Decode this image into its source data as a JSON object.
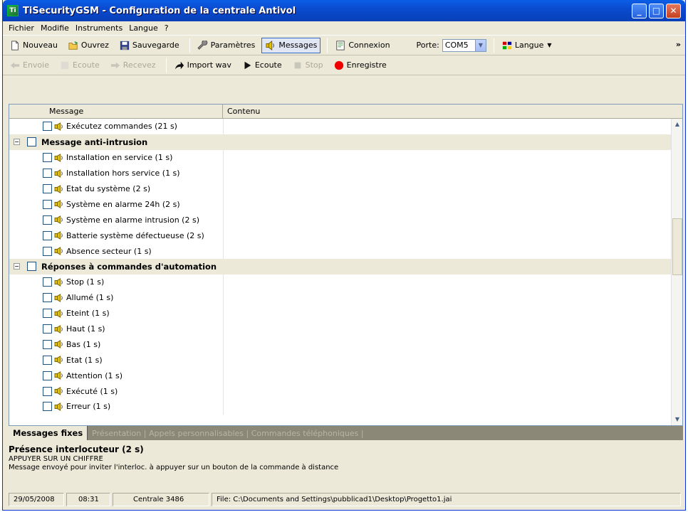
{
  "window": {
    "title": "TiSecurityGSM - Configuration de la centrale Antivol",
    "minimize": "_",
    "maximize": "□",
    "close": "✕"
  },
  "menu": [
    "Fichier",
    "Modifie",
    "Instruments",
    "Langue",
    "?"
  ],
  "toolbar1": {
    "new": "Nouveau",
    "open": "Ouvrez",
    "save": "Sauvegarde",
    "params": "Paramètres",
    "messages": "Messages",
    "connect": "Connexion",
    "port_label": "Porte:",
    "port_value": "COM5",
    "language": "Langue",
    "overflow": "»"
  },
  "toolbar2": {
    "send": "Envoie",
    "listen_dis": "Ecoute",
    "receive": "Recevez",
    "import": "Import wav",
    "listen": "Ecoute",
    "stop": "Stop",
    "record": "Enregistre"
  },
  "grid": {
    "col_message": "Message",
    "col_content": "Contenu",
    "rows": [
      {
        "kind": "item",
        "label": "Exécutez commandes (21 s)"
      },
      {
        "kind": "group",
        "label": "Message anti-intrusion"
      },
      {
        "kind": "item",
        "label": "Installation en service (1 s)"
      },
      {
        "kind": "item",
        "label": "Installation hors service (1 s)"
      },
      {
        "kind": "item",
        "label": "Etat du système (2 s)"
      },
      {
        "kind": "item",
        "label": "Système en alarme 24h (2 s)"
      },
      {
        "kind": "item",
        "label": "Système en alarme intrusion (2 s)"
      },
      {
        "kind": "item",
        "label": "Batterie système défectueuse (2 s)"
      },
      {
        "kind": "item",
        "label": "Absence secteur (1 s)"
      },
      {
        "kind": "group",
        "label": "Réponses à commandes d'automation"
      },
      {
        "kind": "item",
        "label": "Stop (1 s)"
      },
      {
        "kind": "item",
        "label": "Allumé (1 s)"
      },
      {
        "kind": "item",
        "label": "Eteint (1 s)"
      },
      {
        "kind": "item",
        "label": "Haut (1 s)"
      },
      {
        "kind": "item",
        "label": "Bas (1 s)"
      },
      {
        "kind": "item",
        "label": "Etat (1 s)"
      },
      {
        "kind": "item",
        "label": "Attention (1 s)"
      },
      {
        "kind": "item",
        "label": "Exécuté (1 s)"
      },
      {
        "kind": "item",
        "label": "Erreur (1 s)"
      }
    ]
  },
  "tabs": {
    "active": "Messages fixes",
    "inactive": "Présentation | Appels personnalisables | Commandes téléphoniques |"
  },
  "detail": {
    "title": "Présence interlocuteur (2 s)",
    "line1": "APPUYER SUR UN CHIFFRE",
    "line2": "Message envoyé pour inviter l'interloc. à appuyer sur un bouton de la commande à distance"
  },
  "status": {
    "date": "29/05/2008",
    "time": "08:31",
    "central": "Centrale 3486",
    "file": "File: C:\\Documents and Settings\\pubblicad1\\Desktop\\Progetto1.jai"
  }
}
